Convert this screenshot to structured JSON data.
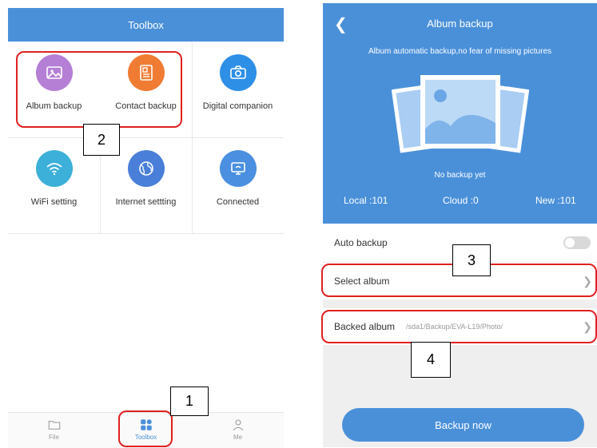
{
  "left": {
    "header_title": "Toolbox",
    "grid": [
      {
        "label": "Album backup",
        "icon": "image-icon",
        "color": "#b57fd6"
      },
      {
        "label": "Contact backup",
        "icon": "contact-card-icon",
        "color": "#f07c34"
      },
      {
        "label": "Digital companion",
        "icon": "camera-icon",
        "color": "#2e8fe6"
      },
      {
        "label": "WiFi setting",
        "icon": "wifi-icon",
        "color": "#3cb0d8"
      },
      {
        "label": "Internet settting",
        "icon": "globe-icon",
        "color": "#4a7fd9"
      },
      {
        "label": "Connected",
        "icon": "monitor-icon",
        "color": "#4a8fe0"
      }
    ],
    "tabs": [
      {
        "label": "File",
        "icon": "folder-icon"
      },
      {
        "label": "Toolbox",
        "icon": "grid-icon"
      },
      {
        "label": "Me",
        "icon": "person-icon"
      }
    ]
  },
  "right": {
    "header_title": "Album backup",
    "subtitle": "Album automatic backup,no fear of missing pictures",
    "status": "No backup yet",
    "stats": {
      "local": "Local :101",
      "cloud": "Cloud :0",
      "new": "New :101"
    },
    "auto_backup_label": "Auto backup",
    "select_album_label": "Select album",
    "backed_album_label": "Backed album",
    "backed_album_path": "/sda1/Backup/EVA-L19/Photo/",
    "backup_button": "Backup now"
  },
  "annotations": {
    "n1": "1",
    "n2": "2",
    "n3": "3",
    "n4": "4"
  },
  "colors": {
    "accent": "#4a90d9",
    "highlight": "#e02020"
  }
}
